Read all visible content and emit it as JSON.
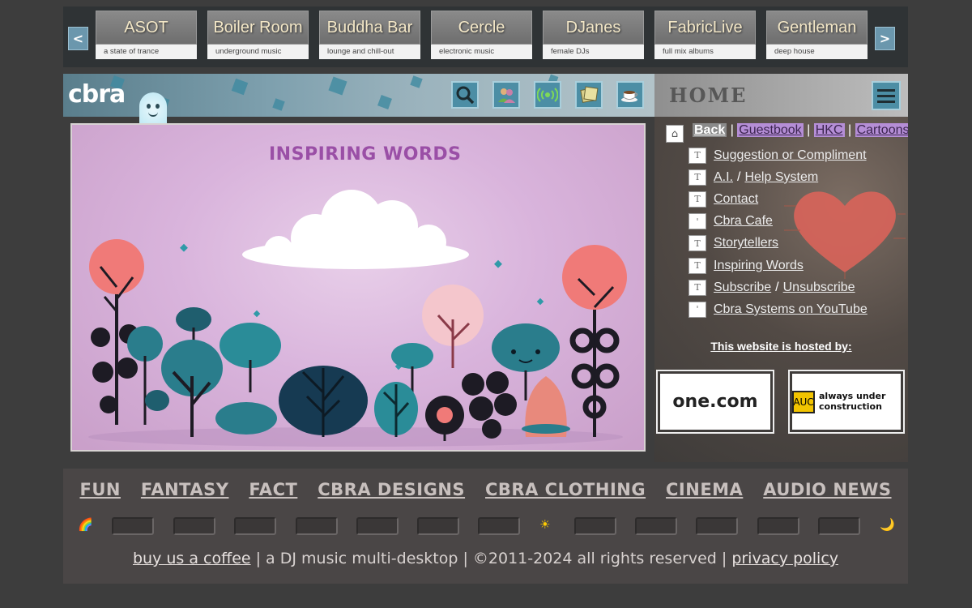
{
  "carousel": {
    "prev": "<",
    "next": ">",
    "stations": [
      {
        "name": "ASOT",
        "sub": "a state of trance"
      },
      {
        "name": "Boiler Room",
        "sub": "underground music"
      },
      {
        "name": "Buddha Bar",
        "sub": "lounge and chill-out"
      },
      {
        "name": "Cercle",
        "sub": "electronic music"
      },
      {
        "name": "DJanes",
        "sub": "female DJs"
      },
      {
        "name": "FabricLive",
        "sub": "full mix albums"
      },
      {
        "name": "Gentleman",
        "sub": "deep house"
      }
    ]
  },
  "header": {
    "logo": "cbra",
    "page_label": "HOME",
    "icons": [
      "search-icon",
      "people-icon",
      "broadcast-icon",
      "notes-icon",
      "coffee-icon"
    ]
  },
  "picture": {
    "title": "INSPIRING WORDS"
  },
  "side": {
    "top_links": [
      "Back",
      "Guestbook",
      "HKC",
      "Cartoons"
    ],
    "menu": [
      {
        "parts": [
          "Suggestion or Compliment"
        ],
        "doc": "T"
      },
      {
        "parts": [
          "A.I.",
          "Help System"
        ],
        "doc": "T"
      },
      {
        "parts": [
          "Contact"
        ],
        "doc": "T"
      },
      {
        "parts": [
          "Cbra Cafe"
        ],
        "doc": "'"
      },
      {
        "parts": [
          "Storytellers"
        ],
        "doc": "T"
      },
      {
        "parts": [
          "Inspiring Words"
        ],
        "doc": "T"
      },
      {
        "parts": [
          "Subscribe",
          "Unsubscribe"
        ],
        "doc": "T"
      },
      {
        "parts": [
          "Cbra Systems on YouTube"
        ],
        "doc": "'"
      }
    ],
    "hosted_label": "This website is hosted by:",
    "host_one": "one.com",
    "host_auc": "always under construction",
    "auc_sign": "AUC"
  },
  "footer": {
    "categories": [
      "FUN",
      "FANTASY",
      "FACT",
      "CBRA DESIGNS",
      "CBRA CLOTHING",
      "CINEMA",
      "AUDIO NEWS"
    ],
    "symbols": {
      "rainbow": "🌈",
      "sun": "☀",
      "moon": "🌙"
    },
    "coffee_link": "buy us a coffee",
    "tagline": " | a DJ music multi-desktop | ",
    "copyright": "©2011-2024 all rights reserved",
    "sep": " | ",
    "privacy": "privacy policy"
  },
  "colors": {
    "accent": "#4c8ea5",
    "title_purple": "#9a4fa6",
    "link_purple_bg": "#b58ed6"
  }
}
